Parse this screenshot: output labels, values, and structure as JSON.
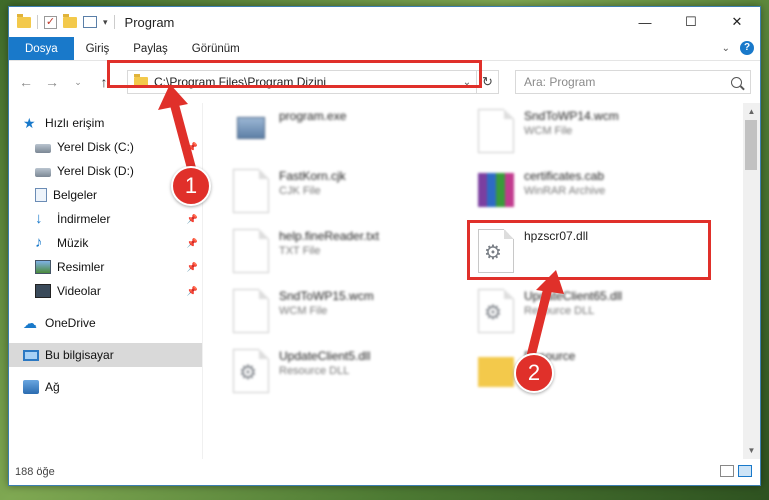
{
  "window": {
    "title": "Program",
    "controls": {
      "minimize": "—",
      "maximize": "☐",
      "close": "✕"
    }
  },
  "ribbon": {
    "tabs": [
      "Dosya",
      "Giriş",
      "Paylaş",
      "Görünüm"
    ]
  },
  "address": {
    "path": "C:\\Program Files\\Program Dizini",
    "search_placeholder": "Ara: Program"
  },
  "sidebar": {
    "quick_access": "Hızlı erişim",
    "items": [
      {
        "label": "Yerel Disk (C:)",
        "icon": "disk-icon"
      },
      {
        "label": "Yerel Disk (D:)",
        "icon": "disk-icon"
      },
      {
        "label": "Belgeler",
        "icon": "documents-icon"
      },
      {
        "label": "İndirmeler",
        "icon": "download-icon"
      },
      {
        "label": "Müzik",
        "icon": "music-icon"
      },
      {
        "label": "Resimler",
        "icon": "pictures-icon"
      },
      {
        "label": "Videolar",
        "icon": "videos-icon"
      }
    ],
    "onedrive": "OneDrive",
    "this_pc": "Bu bilgisayar",
    "network": "Ağ"
  },
  "files": [
    {
      "name": "program.exe",
      "type": ""
    },
    {
      "name": "SndToWP14.wcm",
      "type": "WCM File"
    },
    {
      "name": "FastKorn.cjk",
      "type": "CJK File"
    },
    {
      "name": "certificates.cab",
      "type": "WinRAR Archive"
    },
    {
      "name": "help.fineReader.txt",
      "type": "TXT File"
    },
    {
      "name": "hpzscr07.dll",
      "type": ""
    },
    {
      "name": "SndToWP15.wcm",
      "type": "WCM File"
    },
    {
      "name": "UpdateClient65.dll",
      "type": "Resource DLL"
    },
    {
      "name": "UpdateClient5.dll",
      "type": "Resource DLL"
    },
    {
      "name": "Resource",
      "type": ""
    }
  ],
  "status": {
    "item_count": "188 öğe"
  },
  "annotations": {
    "step1": "1",
    "step2": "2",
    "color": "#e0302a"
  }
}
